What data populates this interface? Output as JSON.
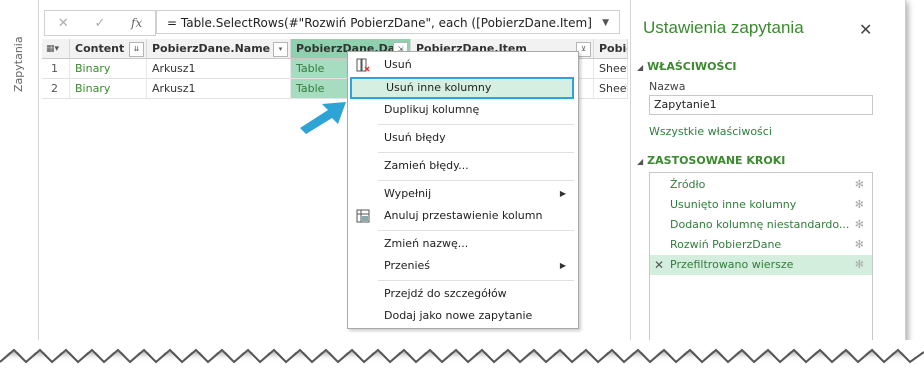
{
  "left_pane": {
    "label": "Zapytania"
  },
  "formula_bar": {
    "cancel_icon": "✕",
    "confirm_icon": "✓",
    "fx_label": "fx",
    "formula": "= Table.SelectRows(#\"Rozwiń PobierzDane\", each ([PobierzDane.Item]",
    "dropdown_icon": "▼"
  },
  "grid": {
    "corner_icon": "▦▾",
    "columns": [
      {
        "label": "Content",
        "btn": "⇊"
      },
      {
        "label": "PobierzDane.Name",
        "btn": "▾"
      },
      {
        "label": "PobierzDane.Data",
        "btn": "⇲"
      },
      {
        "label": "PobierzDane.Item",
        "btn": "⊻"
      },
      {
        "label": "Pobie",
        "btn": ""
      }
    ],
    "rows": [
      {
        "num": "1",
        "content": "Binary",
        "name": "Arkusz1",
        "data": "Table",
        "item": "",
        "extra": "Sheet"
      },
      {
        "num": "2",
        "content": "Binary",
        "name": "Arkusz1",
        "data": "Table",
        "item": "",
        "extra": "Sheet"
      }
    ]
  },
  "context_menu": {
    "items": [
      {
        "label": "Usuń"
      },
      {
        "label": "Usuń inne kolumny"
      },
      {
        "label": "Duplikuj kolumnę"
      },
      {
        "label": "Usuń błędy"
      },
      {
        "label": "Zamień błędy..."
      },
      {
        "label": "Wypełnij",
        "arrow": "▶"
      },
      {
        "label": "Anuluj przestawienie kolumn"
      },
      {
        "label": "Zmień nazwę..."
      },
      {
        "label": "Przenieś",
        "arrow": "▶"
      },
      {
        "label": "Przejdź do szczegółów"
      },
      {
        "label": "Dodaj jako nowe zapytanie"
      }
    ]
  },
  "query_settings": {
    "title": "Ustawienia zapytania",
    "close": "✕",
    "properties_header": "WŁAŚCIWOŚCI",
    "name_label": "Nazwa",
    "name_value": "Zapytanie1",
    "all_properties_link": "Wszystkie właściwości",
    "steps_header": "ZASTOSOWANE KROKI",
    "steps": [
      {
        "label": "Źródło"
      },
      {
        "label": "Usunięto inne kolumny"
      },
      {
        "label": "Dodano kolumnę niestandardo..."
      },
      {
        "label": "Rozwiń PobierzDane"
      },
      {
        "label": "Przefiltrowano wiersze",
        "selected": true
      }
    ],
    "gear": "✻",
    "delete_icon": "✕"
  },
  "colors": {
    "accent_green": "#3a8a2e",
    "selected_column": "#8fd1ae",
    "highlight_border": "#2ea3d6",
    "callout_arrow": "#2ea3d6"
  }
}
